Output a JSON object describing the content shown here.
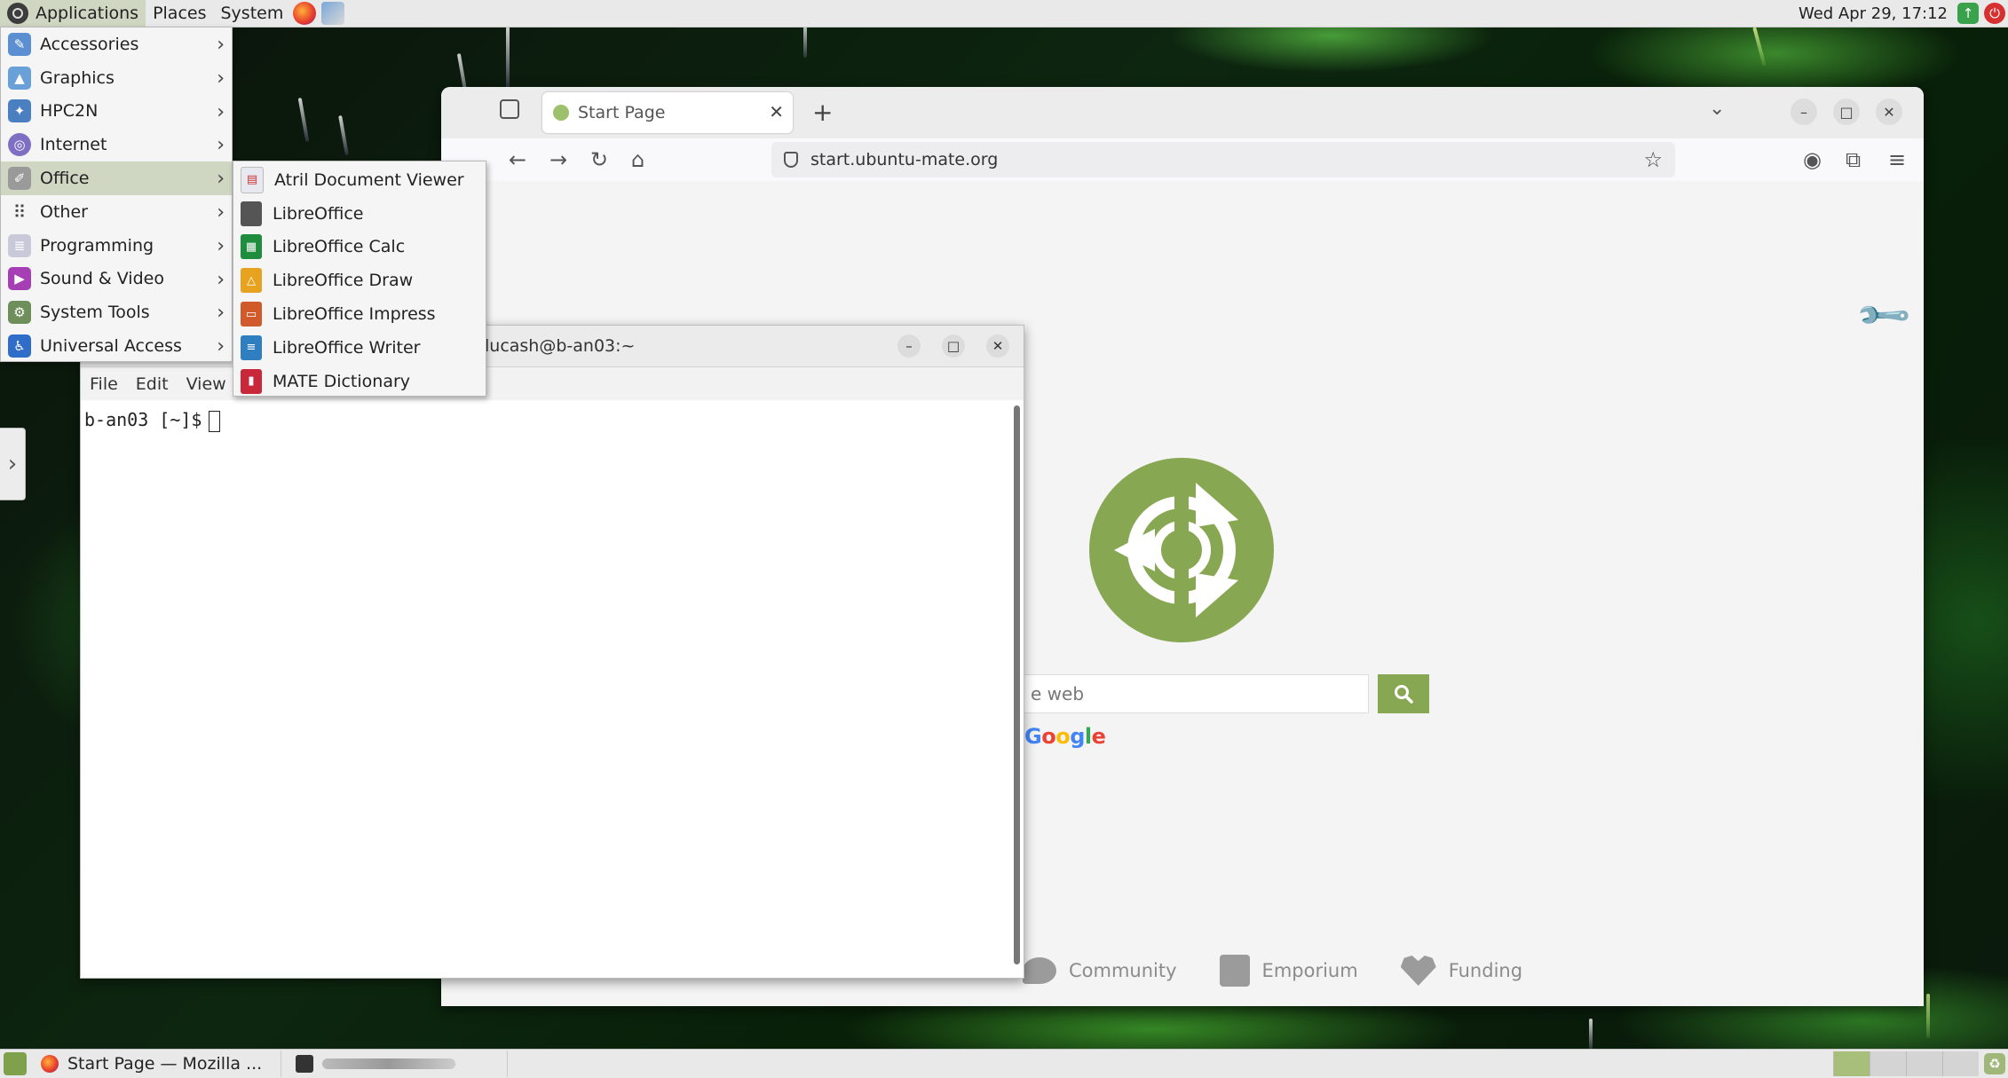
{
  "top_panel": {
    "menus": [
      "Applications",
      "Places",
      "System"
    ],
    "clock": "Wed Apr 29, 17:12"
  },
  "apps_menu": {
    "items": [
      {
        "label": "Accessories",
        "icon": "accessories-icon",
        "color": "#5b8fd1"
      },
      {
        "label": "Graphics",
        "icon": "graphics-icon",
        "color": "#6aa0d8"
      },
      {
        "label": "HPC2N",
        "icon": "hpc2n-icon",
        "color": "#4a7fc2"
      },
      {
        "label": "Internet",
        "icon": "internet-icon",
        "color": "#7f6fc4"
      },
      {
        "label": "Office",
        "icon": "office-icon",
        "color": "#9a9a9a"
      },
      {
        "label": "Other",
        "icon": "other-icon",
        "color": "#444444"
      },
      {
        "label": "Programming",
        "icon": "programming-icon",
        "color": "#c9c9d9"
      },
      {
        "label": "Sound & Video",
        "icon": "sound-video-icon",
        "color": "#a53fb3"
      },
      {
        "label": "System Tools",
        "icon": "system-tools-icon",
        "color": "#6f8f5a"
      },
      {
        "label": "Universal Access",
        "icon": "universal-access-icon",
        "color": "#2f6dc8"
      }
    ],
    "hovered": "Office"
  },
  "office_submenu": {
    "items": [
      {
        "label": "Atril Document Viewer",
        "icon": "atril-icon",
        "color": "#e8e8f0"
      },
      {
        "label": "LibreOffice",
        "icon": "libreoffice-icon",
        "color": "#555555"
      },
      {
        "label": "LibreOffice Calc",
        "icon": "libreoffice-calc-icon",
        "color": "#1e8d3e"
      },
      {
        "label": "LibreOffice Draw",
        "icon": "libreoffice-draw-icon",
        "color": "#e7a31f"
      },
      {
        "label": "LibreOffice Impress",
        "icon": "libreoffice-impress-icon",
        "color": "#d05a2a"
      },
      {
        "label": "LibreOffice Writer",
        "icon": "libreoffice-writer-icon",
        "color": "#2f7fc0"
      },
      {
        "label": "MATE Dictionary",
        "icon": "mate-dictionary-icon",
        "color": "#c8283a"
      }
    ]
  },
  "firefox": {
    "tab_title": "Start Page",
    "url": "start.ubuntu-mate.org",
    "search_placeholder": "e web",
    "search_provider": "Google",
    "links": [
      "Community",
      "Emporium",
      "Funding"
    ],
    "accent": "#87a752"
  },
  "terminal": {
    "title": "lucash@b-an03:~",
    "menu": [
      "File",
      "Edit",
      "View"
    ],
    "prompt": "b-an03 [~]$"
  },
  "bottom_panel": {
    "tasks": [
      {
        "label": "Start Page — Mozilla ..."
      },
      {
        "label": ""
      }
    ]
  }
}
